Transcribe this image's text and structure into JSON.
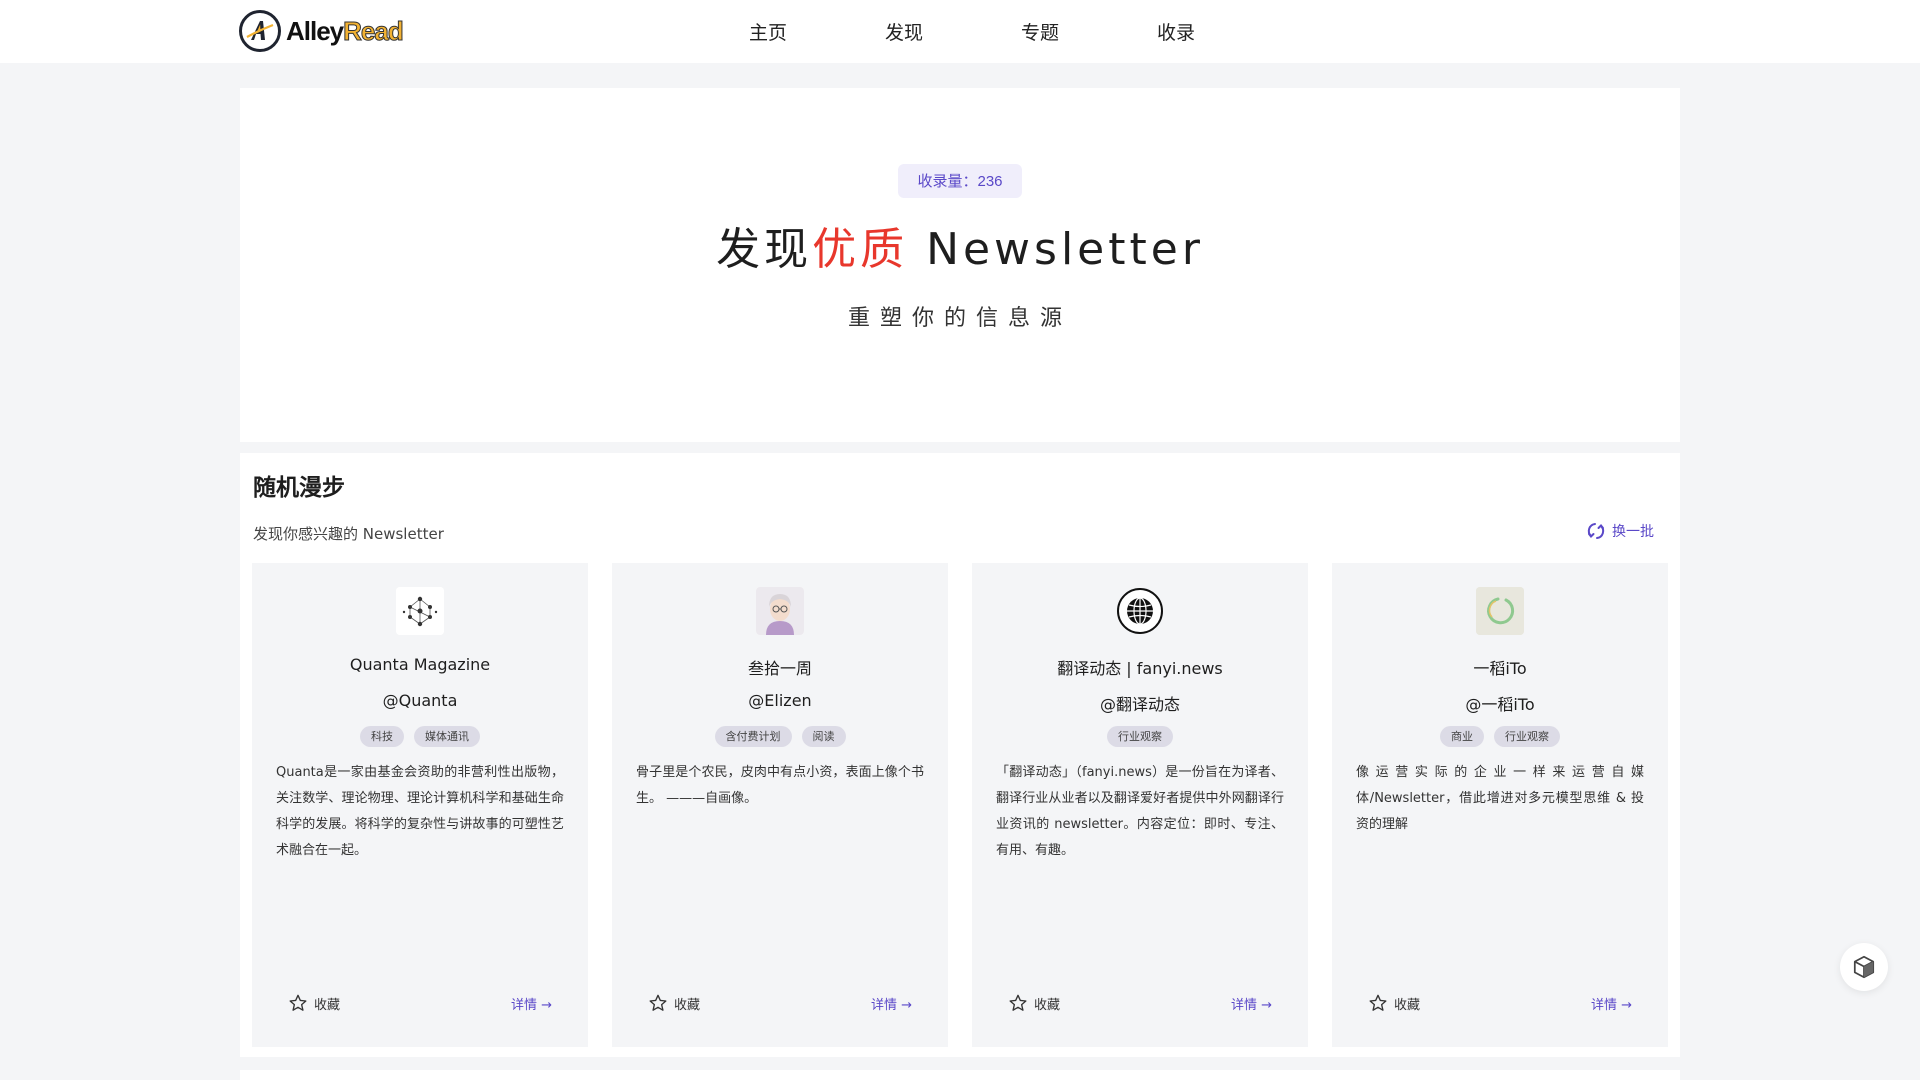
{
  "header": {
    "logo_alley": "Alley",
    "logo_read": "Read",
    "nav": [
      "主页",
      "发现",
      "专题",
      "收录"
    ]
  },
  "hero": {
    "count_label": "收录量：",
    "count_value": "236",
    "title_pre": "发现",
    "title_highlight": "优质",
    "title_post": " Newsletter",
    "subtitle": "重塑你的信息源",
    "highlight_color": "#e8372c"
  },
  "section": {
    "title": "随机漫步",
    "subtitle": "发现你感兴趣的 Newsletter",
    "refresh_label": "换一批",
    "cards": [
      {
        "name": "Quanta Magazine",
        "handle": "@Quanta",
        "tags": [
          "科技",
          "媒体通讯"
        ],
        "description": "Quanta是一家由基金会资助的非营利性出版物，关注数学、理论物理、理论计算机科学和基础生命科学的发展。将科学的复杂性与讲故事的可塑性艺术融合在一起。",
        "favorite_label": "收藏",
        "detail_label": "详情 →",
        "avatar_icon": "molecule-network-icon"
      },
      {
        "name": "叁拾一周",
        "handle": "@Elizen",
        "tags": [
          "含付费计划",
          "阅读"
        ],
        "description": "骨子里是个农民，皮肉中有点小资，表面上像个书生。 ———自画像。",
        "favorite_label": "收藏",
        "detail_label": "详情 →",
        "avatar_icon": "portrait-icon"
      },
      {
        "name": "翻译动态 | fanyi.news",
        "handle": "@翻译动态",
        "tags": [
          "行业观察"
        ],
        "description": "「翻译动态」（fanyi.news）是一份旨在为译者、翻译行业从业者以及翻译爱好者提供中外网翻译行业资讯的 newsletter。内容定位：即时、专注、有用、有趣。",
        "favorite_label": "收藏",
        "detail_label": "详情 →",
        "avatar_icon": "globe-icon"
      },
      {
        "name": "一稻iTo",
        "handle": "@一稻iTo",
        "tags": [
          "商业",
          "行业观察"
        ],
        "description": "像运营实际的企业一样来运营自媒体/Newsletter，借此增进对多元模型思维 & 投资的理解",
        "favorite_label": "收藏",
        "detail_label": "详情 →",
        "avatar_icon": "wreath-icon"
      }
    ]
  },
  "colors": {
    "accent": "#5a48c8",
    "background": "#f4f5f7",
    "card": "#f4f5f7",
    "tag": "#dcdbe6"
  }
}
